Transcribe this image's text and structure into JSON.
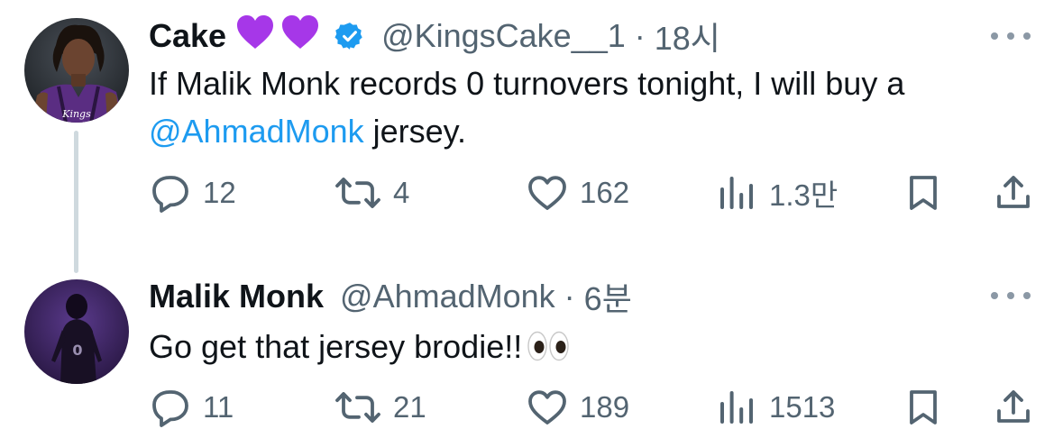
{
  "tweets": [
    {
      "author": {
        "name": "Cake",
        "handle": "@KingsCake__1",
        "time_sep": "·",
        "time": "18시",
        "verified": true,
        "badges": [
          "purple-heart-icon",
          "purple-heart-icon"
        ]
      },
      "text": {
        "before": "If Malik Monk records 0 turnovers tonight, I will buy a",
        "mention": "@AhmadMonk",
        "after": " jersey."
      },
      "actions": {
        "reply": "12",
        "retweet": "4",
        "like": "162",
        "views": "1.3만"
      }
    },
    {
      "author": {
        "name": "Malik Monk",
        "handle": "@AhmadMonk",
        "time_sep": "·",
        "time": "6분",
        "verified": false
      },
      "text": {
        "body": "Go get that jersey brodie!!",
        "emoji": "eyes-emoji"
      },
      "actions": {
        "reply": "11",
        "retweet": "21",
        "like": "189",
        "views": "1513"
      }
    }
  ],
  "colors": {
    "accent": "#1d9bf0",
    "secondary_text": "#536471",
    "heart_emoji": "#a637e8",
    "thread_line": "#cfd9de"
  }
}
